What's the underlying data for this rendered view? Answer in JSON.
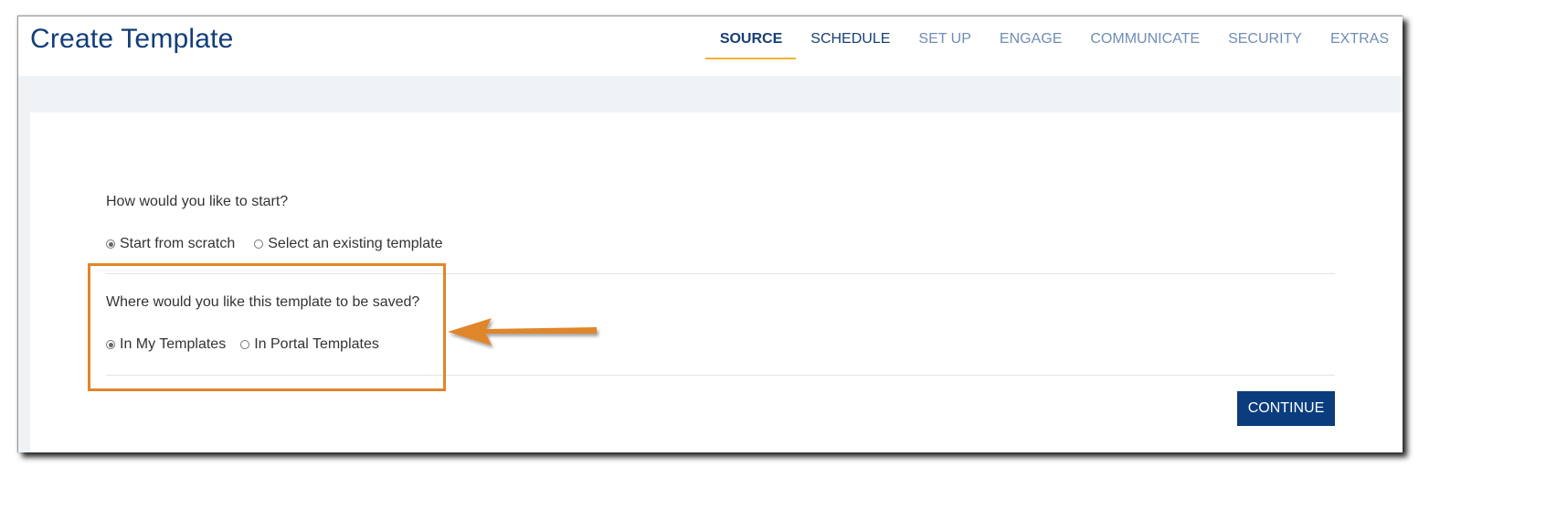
{
  "header": {
    "title": "Create Template",
    "tabs": [
      {
        "label": "SOURCE",
        "state": "active"
      },
      {
        "label": "SCHEDULE",
        "state": "visited"
      },
      {
        "label": "SET UP",
        "state": "inactive"
      },
      {
        "label": "ENGAGE",
        "state": "inactive"
      },
      {
        "label": "COMMUNICATE",
        "state": "inactive"
      },
      {
        "label": "SECURITY",
        "state": "inactive"
      },
      {
        "label": "EXTRAS",
        "state": "inactive"
      }
    ]
  },
  "form": {
    "start": {
      "question": "How would you like to start?",
      "options": [
        {
          "label": "Start from scratch",
          "checked": true
        },
        {
          "label": "Select an existing template",
          "checked": false
        }
      ]
    },
    "save_location": {
      "question": "Where would you like this template to be saved?",
      "options": [
        {
          "label": "In My Templates",
          "checked": true
        },
        {
          "label": "In Portal Templates",
          "checked": false
        }
      ]
    },
    "continue_label": "CONTINUE"
  },
  "annotation": {
    "highlight_color": "#e0862a",
    "arrow_color": "#e0862a",
    "accent_tab_underline": "#f2b233",
    "primary_color": "#0b3d7e"
  }
}
